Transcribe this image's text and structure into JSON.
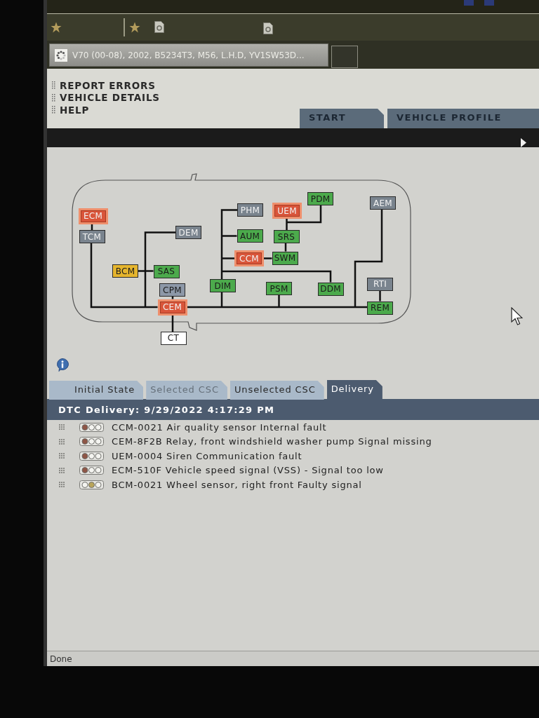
{
  "vehicle_tab": {
    "label": "V70 (00-08), 2002, B5234T3, M56, L.H.D, YV1SW53D..."
  },
  "menu": {
    "items": [
      "REPORT ERRORS",
      "VEHICLE DETAILS",
      "HELP"
    ]
  },
  "main_tabs": [
    {
      "label": "START",
      "selected": false
    },
    {
      "label": "VEHICLE PROFILE",
      "selected": false
    }
  ],
  "diagram": {
    "nodes": [
      {
        "label": "ECM",
        "color": "#d9553a",
        "fault": true
      },
      {
        "label": "TCM",
        "color": "#7a848e",
        "fault": false
      },
      {
        "label": "DEM",
        "color": "#7a848e",
        "fault": false
      },
      {
        "label": "BCM",
        "color": "#e5b52e",
        "fault": false
      },
      {
        "label": "SAS",
        "color": "#4caa4c",
        "fault": false
      },
      {
        "label": "CPM",
        "color": "#8d98a8",
        "fault": false
      },
      {
        "label": "CEM",
        "color": "#d9553a",
        "fault": true
      },
      {
        "label": "CT",
        "color": "#ffffff",
        "fault": false
      },
      {
        "label": "PHM",
        "color": "#7a848e",
        "fault": false
      },
      {
        "label": "AUM",
        "color": "#4caa4c",
        "fault": false
      },
      {
        "label": "CCM",
        "color": "#d9553a",
        "fault": true
      },
      {
        "label": "DIM",
        "color": "#4caa4c",
        "fault": false
      },
      {
        "label": "UEM",
        "color": "#d9553a",
        "fault": true
      },
      {
        "label": "PDM",
        "color": "#4caa4c",
        "fault": false
      },
      {
        "label": "SRS",
        "color": "#4caa4c",
        "fault": false
      },
      {
        "label": "SWM",
        "color": "#4caa4c",
        "fault": false
      },
      {
        "label": "PSM",
        "color": "#4caa4c",
        "fault": false
      },
      {
        "label": "DDM",
        "color": "#4caa4c",
        "fault": false
      },
      {
        "label": "AEM",
        "color": "#7a848e",
        "fault": false
      },
      {
        "label": "RTI",
        "color": "#7a848e",
        "fault": false
      },
      {
        "label": "REM",
        "color": "#4caa4c",
        "fault": false
      }
    ]
  },
  "dtc_tabs": [
    {
      "label": "Initial State",
      "selected": false,
      "disabled": false
    },
    {
      "label": "Selected CSC",
      "selected": false,
      "disabled": true
    },
    {
      "label": "Unselected CSC",
      "selected": false,
      "disabled": false
    },
    {
      "label": "Delivery",
      "selected": true,
      "disabled": false
    }
  ],
  "dtc": {
    "title": "DTC Delivery: 9/29/2022 4:17:29 PM",
    "rows": [
      {
        "kind": "fault",
        "text": "CCM-0021 Air quality sensor Internal fault"
      },
      {
        "kind": "fault",
        "text": "CEM-8F2B Relay, front windshield washer pump Signal missing"
      },
      {
        "kind": "fault",
        "text": "UEM-0004 Siren Communication fault"
      },
      {
        "kind": "fault",
        "text": "ECM-510F Vehicle speed signal (VSS) - Signal too low"
      },
      {
        "kind": "warning",
        "text": "BCM-0021 Wheel sensor, right front Faulty signal"
      }
    ]
  },
  "status_bar": {
    "text": "Done"
  }
}
